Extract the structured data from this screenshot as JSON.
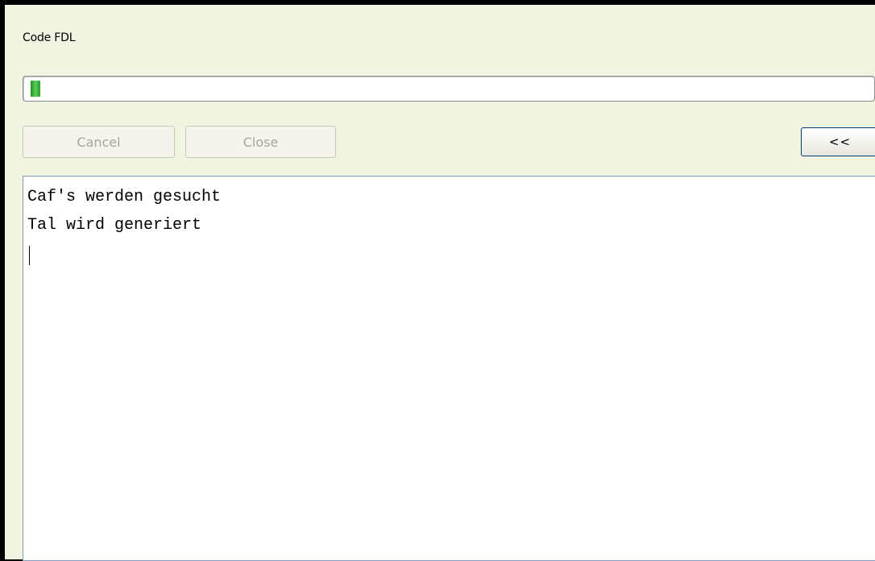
{
  "window": {
    "title": "Code FDL"
  },
  "progress": {
    "value_percent": 1.2,
    "fill_color": "#2faa2f"
  },
  "buttons": {
    "cancel_label": "Cancel",
    "close_label": "Close",
    "toggle_label": "<<"
  },
  "log": {
    "lines": [
      "Caf's werden gesucht",
      "Tal wird generiert"
    ]
  }
}
